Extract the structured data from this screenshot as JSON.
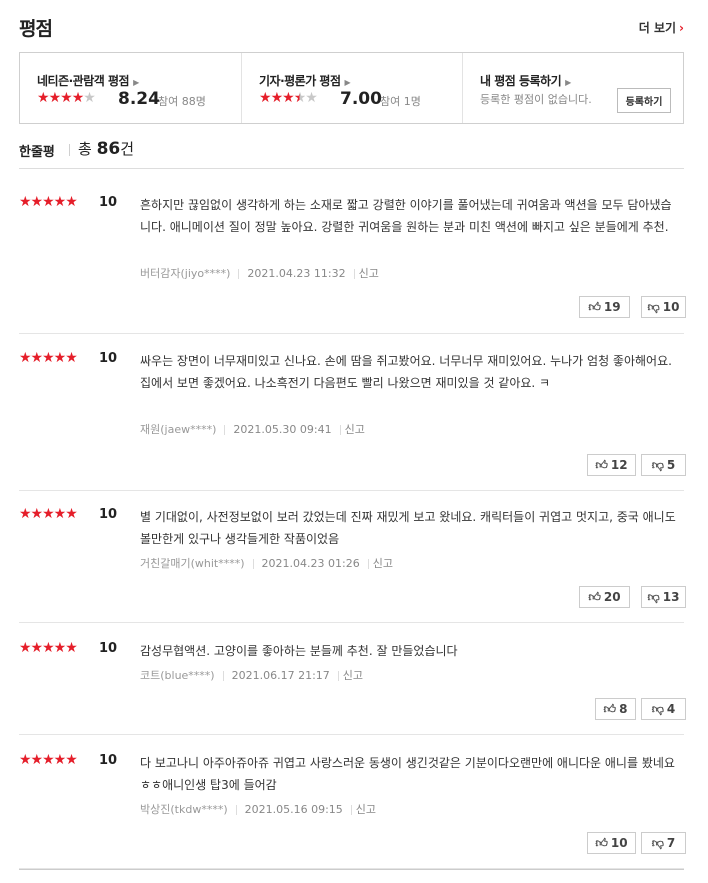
{
  "header": {
    "title": "평점",
    "more_label": "더 보기",
    "more_icon": "chevron-right-icon"
  },
  "summary": {
    "netizen": {
      "title": "네티즌·관람객 평점",
      "score": "8.24",
      "participants": "참여 88명",
      "stars": [
        1,
        1,
        1,
        1,
        0
      ]
    },
    "critic": {
      "title": "기자·평론가 평점",
      "score": "7.00",
      "participants": "참여 1명",
      "stars": [
        1,
        1,
        1,
        0.5,
        0
      ]
    },
    "mine": {
      "title": "내 평점 등록하기",
      "description": "등록한 평점이 없습니다.",
      "button_label": "등록하기"
    }
  },
  "total": {
    "label": "한줄평",
    "prefix": "총",
    "count": "86",
    "suffix": "건"
  },
  "reviews": [
    {
      "stars": 5,
      "score": "10",
      "text": "흔하지만 끊임없이 생각하게 하는 소재로 짧고 강렬한 이야기를 풀어냈는데 귀여움과 액션을 모두 담아냈습니다. 애니메이션 질이 정말 높아요. 강렬한 귀여움을 원하는 분과 미친 액션에 빠지고 싶은 분들에게 추천.",
      "author": "버터감자(jiyo****)",
      "date": "2021.04.23 11:32",
      "report": "신고",
      "likes": "19",
      "dislikes": "10"
    },
    {
      "stars": 5,
      "score": "10",
      "text": "싸우는 장면이 너무재미있고 신나요. 손에 땀을 쥐고봤어요. 너무너무 재미있어요. 누나가 엄청 좋아해어요. 집에서 보면 좋겠어요. 나소흑전기 다음편도 빨리 나왔으면 재미있을 것 같아요. ㅋ",
      "author": "재원(jaew****)",
      "date": "2021.05.30 09:41",
      "report": "신고",
      "likes": "12",
      "dislikes": "5"
    },
    {
      "stars": 5,
      "score": "10",
      "text": "별 기대없이, 사전정보없이 보러 갔었는데 진짜 재밌게 보고 왔네요. 캐릭터들이 귀엽고 멋지고, 중국 애니도 볼만한게 있구나 생각들게한 작품이었음",
      "author": "거친갈매기(whit****)",
      "date": "2021.04.23 01:26",
      "report": "신고",
      "likes": "20",
      "dislikes": "13"
    },
    {
      "stars": 5,
      "score": "10",
      "text": "감성무협액션. 고양이를 좋아하는 분들께 추천. 잘 만들었습니다",
      "author": "코트(blue****)",
      "date": "2021.06.17 21:17",
      "report": "신고",
      "likes": "8",
      "dislikes": "4"
    },
    {
      "stars": 5,
      "score": "10",
      "text": "다 보고나니 아주아쥬아쥬 귀엽고 사랑스러운 동생이 생긴것같은 기분이다오랜만에 애니다운 애니를 봤네요 ㅎㅎ애니인생 탑3에 들어감",
      "author": "박상진(tkdw****)",
      "date": "2021.05.16 09:15",
      "report": "신고",
      "likes": "10",
      "dislikes": "7"
    }
  ]
}
